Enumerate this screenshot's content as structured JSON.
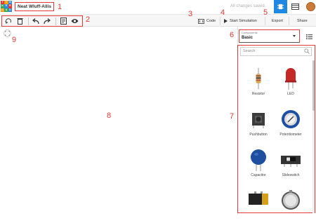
{
  "header": {
    "circuit_name": "Neat Wluff-Allis",
    "save_status": "All changes saved",
    "logo_letters": [
      "T",
      "I",
      "N",
      "K",
      "E",
      "R",
      "C",
      "A",
      "D"
    ]
  },
  "toolbar": {
    "code_label": "Code",
    "start_simulation_label": "Start Simulation",
    "export_label": "Export",
    "share_label": "Share"
  },
  "annotations": [
    "1",
    "2",
    "3",
    "4",
    "5",
    "6",
    "7",
    "8",
    "9"
  ],
  "panel": {
    "components_label": "Components",
    "components_value": "Basic",
    "search_placeholder": "Search",
    "items": [
      {
        "label": "Resistor",
        "icon": "resistor-icon"
      },
      {
        "label": "LED",
        "icon": "led-icon"
      },
      {
        "label": "Pushbutton",
        "icon": "pushbutton-icon"
      },
      {
        "label": "Potentiometer",
        "icon": "potentiometer-icon"
      },
      {
        "label": "Capacitor",
        "icon": "capacitor-icon"
      },
      {
        "label": "Slideswitch",
        "icon": "slideswitch-icon"
      },
      {
        "label": "",
        "icon": "battery-icon"
      },
      {
        "label": "",
        "icon": "coin-cell-icon"
      }
    ]
  },
  "colors": {
    "accent": "#1e88e5",
    "annotation": "#e53935",
    "led": "#c62828",
    "capacitor": "#1e4fa0"
  }
}
